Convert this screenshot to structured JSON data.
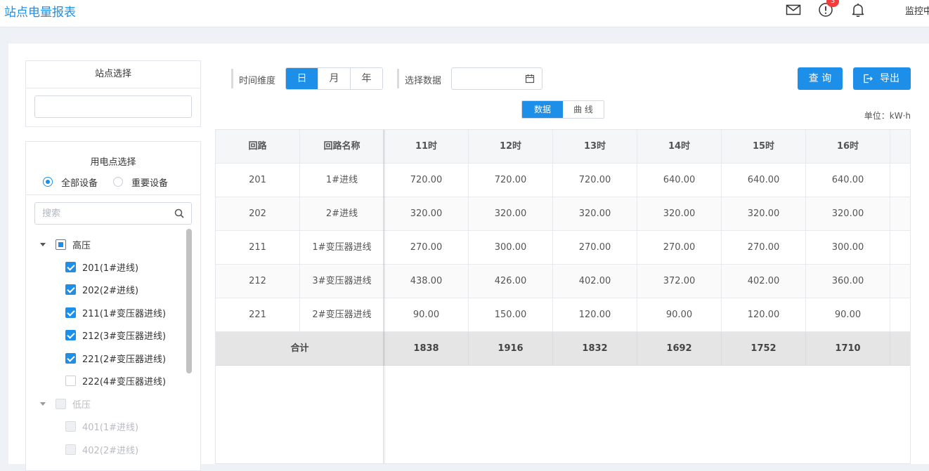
{
  "header": {
    "title": "站点电量报表",
    "notification_count": "3",
    "user_label": "监控中"
  },
  "station_panel": {
    "title": "站点选择",
    "input_value": ""
  },
  "device_panel": {
    "title": "用电点选择",
    "radio_options": [
      {
        "label": "全部设备",
        "selected": true
      },
      {
        "label": "重要设备",
        "selected": false
      }
    ],
    "search_placeholder": "搜索",
    "tree": [
      {
        "label": "高压",
        "state": "partial",
        "expanded": true,
        "level": 0,
        "disabled": false
      },
      {
        "label": "201(1#进线)",
        "state": "checked",
        "level": 1,
        "disabled": false
      },
      {
        "label": "202(2#进线)",
        "state": "checked",
        "level": 1,
        "disabled": false
      },
      {
        "label": "211(1#变压器进线)",
        "state": "checked",
        "level": 1,
        "disabled": false
      },
      {
        "label": "212(3#变压器进线)",
        "state": "checked",
        "level": 1,
        "disabled": false
      },
      {
        "label": "221(2#变压器进线)",
        "state": "checked",
        "level": 1,
        "disabled": false
      },
      {
        "label": "222(4#变压器进线)",
        "state": "unchecked",
        "level": 1,
        "disabled": false
      },
      {
        "label": "低压",
        "state": "unchecked",
        "expanded": true,
        "level": 0,
        "disabled": true
      },
      {
        "label": "401(1#进线)",
        "state": "unchecked",
        "level": 1,
        "disabled": true
      },
      {
        "label": "402(2#进线)",
        "state": "unchecked",
        "level": 1,
        "disabled": true
      }
    ]
  },
  "toolbar": {
    "time_dim_label": "时间维度",
    "time_options": [
      "日",
      "月",
      "年"
    ],
    "time_active": "日",
    "date_label": "选择数据",
    "date_value": "",
    "query_label": "查 询",
    "export_label": "导出",
    "view_options": [
      "数据",
      "曲 线"
    ],
    "view_active": "数据",
    "unit_label": "单位：kW·h"
  },
  "table": {
    "columns": [
      "回路",
      "回路名称",
      "11时",
      "12时",
      "13时",
      "14时",
      "15时",
      "16时"
    ],
    "rows": [
      [
        "201",
        "1#进线",
        "720.00",
        "720.00",
        "720.00",
        "640.00",
        "640.00",
        "640.00"
      ],
      [
        "202",
        "2#进线",
        "320.00",
        "320.00",
        "320.00",
        "320.00",
        "320.00",
        "320.00"
      ],
      [
        "211",
        "1#变压器进线",
        "270.00",
        "300.00",
        "270.00",
        "270.00",
        "270.00",
        "300.00"
      ],
      [
        "212",
        "3#变压器进线",
        "438.00",
        "426.00",
        "402.00",
        "372.00",
        "402.00",
        "360.00"
      ],
      [
        "221",
        "2#变压器进线",
        "90.00",
        "150.00",
        "120.00",
        "90.00",
        "120.00",
        "90.00"
      ]
    ],
    "total_label": "合计",
    "totals": [
      "1838",
      "1916",
      "1832",
      "1692",
      "1752",
      "1710"
    ]
  },
  "colors": {
    "accent": "#1e8fe8",
    "badge": "#f23c3c"
  }
}
